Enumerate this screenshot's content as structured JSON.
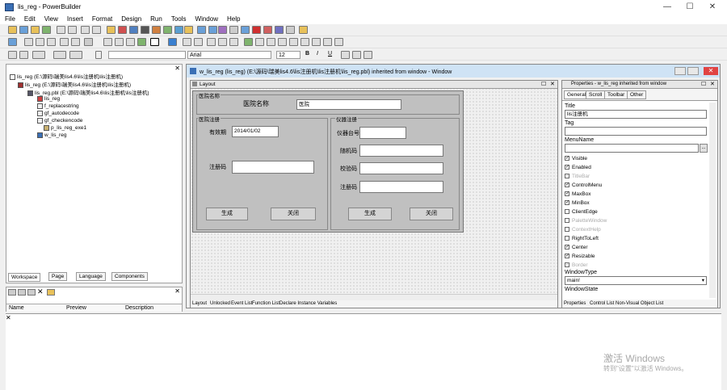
{
  "window": {
    "title": "lis_reg - PowerBuilder",
    "min": "—",
    "max": "☐",
    "close": "✕"
  },
  "menu": [
    "File",
    "Edit",
    "View",
    "Insert",
    "Format",
    "Design",
    "Run",
    "Tools",
    "Window",
    "Help"
  ],
  "style_bar": {
    "font": "Arial",
    "size": "12",
    "bold": "B",
    "italic": "I",
    "underline": "U"
  },
  "workspace": {
    "tree": [
      "lis_reg (E:\\源码\\瑞美lis4.6\\lis注册机\\lis注册机)",
      "lis_reg (E:\\源码\\瑞美lis4.6\\lis注册机\\lis注册机)",
      "lis_reg.pbl (E:\\源码\\瑞美lis4.6\\lis注册机\\lis注册机)",
      "lis_reg",
      "f_replacestring",
      "gf_autodecode",
      "gf_checkencode",
      "p_lis_reg_exe1",
      "w_lis_reg"
    ],
    "tabs": [
      "Workspace",
      "Page",
      "Language",
      "Components"
    ]
  },
  "list_panel": {
    "columns": [
      "Name",
      "Preview",
      "Description"
    ]
  },
  "painter": {
    "title": "w_lis_reg (lis_reg) (E:\\源码\\瑞美lis4.6\\lis注册机\\lis注册机\\lis_reg.pbl) inherited from window - Window",
    "layout_title": "Layout",
    "form": {
      "group_hospital": "医院名称",
      "hospital_label": "医院名称",
      "hospital_value": "医院",
      "group_hosp_reg": "医院注册",
      "expiry_label": "有效期",
      "expiry_value": "2014/01/02",
      "regcode_label": "注册码",
      "gen_btn_1": "生成",
      "close_btn_1": "关闭",
      "group_inst_reg": "仪器注册",
      "inst_num_label": "仪器台号",
      "random_label": "随机码",
      "check_label": "校验码",
      "inst_regcode_label": "注册码",
      "gen_btn_2": "生成",
      "close_btn_2": "关闭"
    },
    "bottom_tabs": [
      "Layout",
      "Unlocked",
      "Event List",
      "Function List",
      "Declare Instance Variables"
    ]
  },
  "properties": {
    "title": "Properties - w_lis_reg inherited from window",
    "tabs": [
      "General",
      "Scroll",
      "Toolbar",
      "Other"
    ],
    "title_label": "Title",
    "title_value": "lis注册机",
    "tag_label": "Tag",
    "menuname_label": "MenuName",
    "checks": [
      {
        "label": "Visible",
        "checked": true,
        "enabled": true
      },
      {
        "label": "Enabled",
        "checked": true,
        "enabled": true
      },
      {
        "label": "TitleBar",
        "checked": true,
        "enabled": false
      },
      {
        "label": "ControlMenu",
        "checked": true,
        "enabled": true
      },
      {
        "label": "MaxBox",
        "checked": true,
        "enabled": true
      },
      {
        "label": "MinBox",
        "checked": true,
        "enabled": true
      },
      {
        "label": "ClientEdge",
        "checked": false,
        "enabled": true
      },
      {
        "label": "PaletteWindow",
        "checked": false,
        "enabled": false
      },
      {
        "label": "ContextHelp",
        "checked": false,
        "enabled": false
      },
      {
        "label": "RightToLeft",
        "checked": false,
        "enabled": true
      },
      {
        "label": "Center",
        "checked": true,
        "enabled": true
      },
      {
        "label": "Resizable",
        "checked": true,
        "enabled": true
      },
      {
        "label": "Border",
        "checked": true,
        "enabled": false
      }
    ],
    "windowtype_label": "WindowType",
    "windowtype_value": "main!",
    "windowstate_label": "WindowState",
    "bottom_tabs": [
      "Properties",
      "Control List",
      "Non-Visual Object List"
    ]
  },
  "watermark": {
    "line1": "激活 Windows",
    "line2": "转到\"设置\"以激活 Windows。"
  }
}
